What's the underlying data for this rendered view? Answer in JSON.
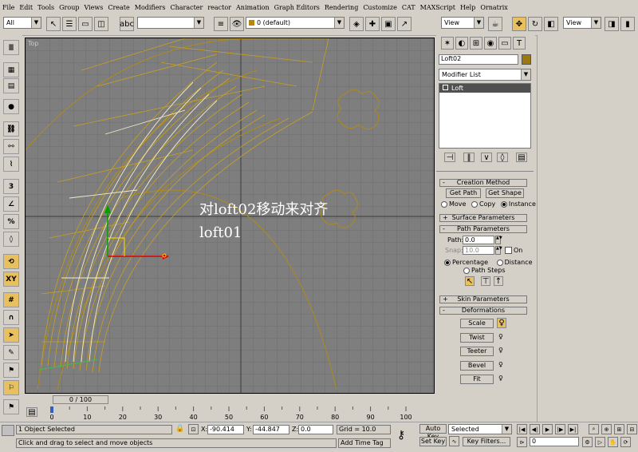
{
  "menu": [
    "File",
    "Edit",
    "Tools",
    "Group",
    "Views",
    "Create",
    "Modifiers",
    "Character",
    "reactor",
    "Animation",
    "Graph Editors",
    "Rendering",
    "Customize",
    "CAT",
    "MAXScript",
    "Help",
    "Ornatrix"
  ],
  "toolbar": {
    "selection_filter": "All",
    "layer": "0 (default)",
    "ref_coord_1": "View",
    "ref_coord_2": "View"
  },
  "viewport": {
    "label": "Top",
    "overlay_line1": "对loft02移动来对齐",
    "overlay_line2": "loft01"
  },
  "panel": {
    "object_name": "Loft02",
    "object_color": "#9a7a10",
    "modifier_list": "Modifier List",
    "stack_item": "Loft",
    "creation_method": {
      "title": "Creation Method",
      "get_path": "Get Path",
      "get_shape": "Get Shape",
      "move": "Move",
      "copy": "Copy",
      "instance": "Instance"
    },
    "surface_parameters": "Surface Parameters",
    "path_parameters": {
      "title": "Path Parameters",
      "path_label": "Path:",
      "path_value": "0.0",
      "snap_label": "Snap:",
      "snap_value": "10.0",
      "on_label": "On",
      "percentage": "Percentage",
      "distance": "Distance",
      "path_steps": "Path Steps"
    },
    "skin_parameters": "Skin Parameters",
    "deformations": {
      "title": "Deformations",
      "scale": "Scale",
      "twist": "Twist",
      "teeter": "Teeter",
      "bevel": "Bevel",
      "fit": "Fit"
    }
  },
  "timeline": {
    "frame": "0 / 100",
    "ticks": [
      "0",
      "10",
      "20",
      "30",
      "40",
      "50",
      "60",
      "70",
      "80",
      "90",
      "100"
    ]
  },
  "status": {
    "selected": "1 Object Selected",
    "prompt": "Click and drag to select and move objects",
    "x_label": "X:",
    "x_value": "-90.414",
    "y_label": "Y:",
    "y_value": "-44.847",
    "z_label": "Z:",
    "z_value": "0.0",
    "grid": "Grid = 10.0",
    "add_time_tag": "Add Time Tag",
    "auto_key": "Auto Key",
    "auto_key_value": "Selected",
    "set_key": "Set Key",
    "key_filters": "Key Filters...",
    "current_frame": "0"
  }
}
